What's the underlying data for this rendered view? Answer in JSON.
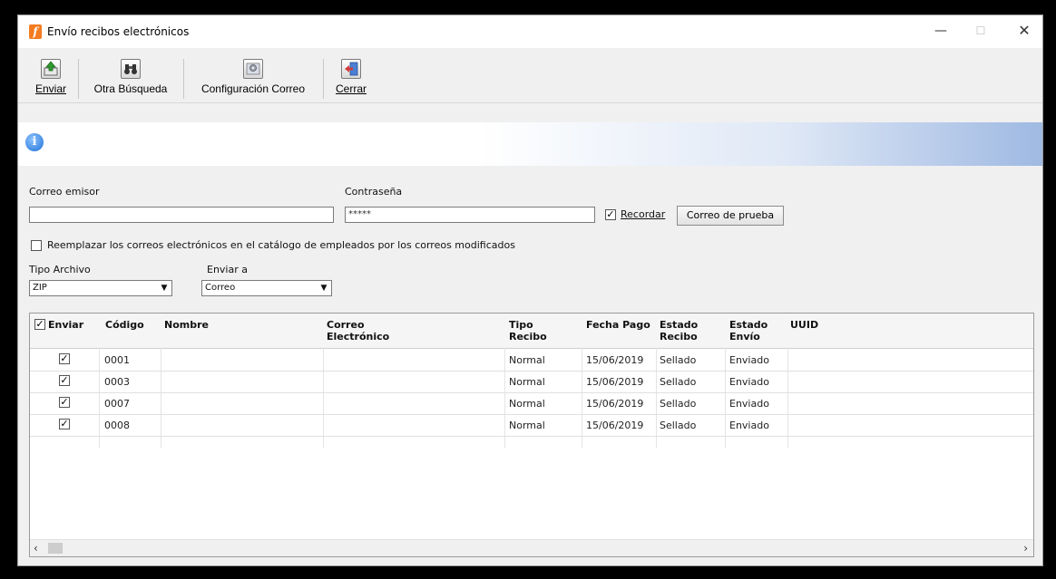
{
  "window": {
    "title": "Envío recibos electrónicos",
    "controls": {
      "minimize": "—",
      "maximize": "☐",
      "close": "✕"
    }
  },
  "toolbar": {
    "enviar": "Enviar",
    "otra_busqueda": "Otra Búsqueda",
    "configuracion_correo": "Configuración Correo",
    "cerrar": "Cerrar"
  },
  "form": {
    "correo_emisor_label": "Correo emisor",
    "correo_emisor_value": "",
    "contrasena_label": "Contraseña",
    "contrasena_value": "*****",
    "recordar_label": "Recordar",
    "recordar_checked": true,
    "correo_prueba_button": "Correo de prueba",
    "reemplazar_label": "Reemplazar los correos electrónicos en el catálogo de empleados por los correos modificados",
    "reemplazar_checked": false,
    "tipo_archivo_label": "Tipo Archivo",
    "tipo_archivo_value": "ZIP",
    "enviar_a_label": "Enviar a",
    "enviar_a_value": "Correo"
  },
  "grid": {
    "headers": {
      "enviar": "Enviar",
      "codigo": "Código",
      "nombre": "Nombre",
      "correo_l1": "Correo",
      "correo_l2": "Electrónico",
      "tipo_l1": "Tipo",
      "tipo_l2": "Recibo",
      "fecha": "Fecha Pago",
      "estado_recibo_l1": "Estado",
      "estado_recibo_l2": "Recibo",
      "estado_envio_l1": "Estado",
      "estado_envio_l2": "Envío",
      "uuid": "UUID"
    },
    "rows": [
      {
        "enviar": true,
        "codigo": "0001",
        "nombre": "",
        "correo": "",
        "tipo": "Normal",
        "fecha": "15/06/2019",
        "estado_recibo": "Sellado",
        "estado_envio": "Enviado",
        "uuid": ""
      },
      {
        "enviar": true,
        "codigo": "0003",
        "nombre": "",
        "correo": "",
        "tipo": "Normal",
        "fecha": "15/06/2019",
        "estado_recibo": "Sellado",
        "estado_envio": "Enviado",
        "uuid": ""
      },
      {
        "enviar": true,
        "codigo": "0007",
        "nombre": "",
        "correo": "",
        "tipo": "Normal",
        "fecha": "15/06/2019",
        "estado_recibo": "Sellado",
        "estado_envio": "Enviado",
        "uuid": ""
      },
      {
        "enviar": true,
        "codigo": "0008",
        "nombre": "",
        "correo": "",
        "tipo": "Normal",
        "fecha": "15/06/2019",
        "estado_recibo": "Sellado",
        "estado_envio": "Enviado",
        "uuid": ""
      }
    ]
  },
  "icons": {
    "app": "app-logo-icon",
    "enviar": "send-upload-icon",
    "otra_busqueda": "binoculars-icon",
    "configuracion": "mail-settings-icon",
    "cerrar": "exit-door-icon",
    "info": "info-icon"
  },
  "colors": {
    "banner_accent": "#9fb9e2",
    "app_icon": "#f47b20",
    "info_blue": "#1e6fd6"
  }
}
